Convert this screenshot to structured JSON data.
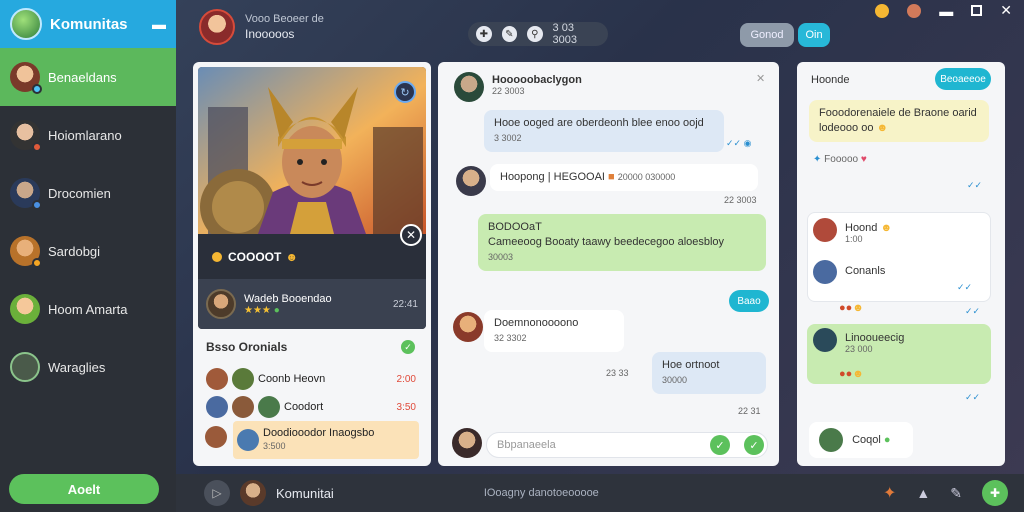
{
  "sidebar": {
    "brand": "Komunitas",
    "items": [
      {
        "label": "Benaeldans",
        "active": true
      },
      {
        "label": "Hoiomlarano"
      },
      {
        "label": "Drocomien"
      },
      {
        "label": "Sardobgi"
      },
      {
        "label": "Hoom Amarta"
      },
      {
        "label": "Waraglies"
      }
    ],
    "bottom_button": "Aoelt"
  },
  "topbar": {
    "subtitle": "Vooo Beoeer de",
    "title": "Inooooos",
    "pill_text": "3 03 3003",
    "button1": "Gonod",
    "button2": "Oin"
  },
  "hero": {
    "name": "COOOOT",
    "user_name": "Wadeb Booendao",
    "time": "22:41"
  },
  "groups": {
    "title": "Bsso Oronials",
    "rows": [
      {
        "label": "Coonb Heovn",
        "time": "2:00"
      },
      {
        "label": "Coodort",
        "time": "3:50"
      },
      {
        "label": "Doodiooodor Inaogsbo",
        "sub": "3:500"
      }
    ]
  },
  "chat": {
    "header_name": "Hooooobaclygon",
    "header_time": "22 3003",
    "messages": [
      {
        "text": "Hooe ooged are oberdeonh blee enoo oojd",
        "time": "3 3002"
      },
      {
        "name": "Hoopong | HEGOOAI",
        "extra": "20000 030000"
      },
      {
        "text": "BODOOaT",
        "text2": "Cameeoog Booaty taawy beedecegoo aloesbloy",
        "time": "30003"
      },
      {
        "button": "Baao"
      },
      {
        "name": "Doemnonoooono",
        "time": "32 3302"
      },
      {
        "text": "Hoe ortnoot",
        "time": "30000"
      }
    ],
    "input_placeholder": "Bbpanaeela"
  },
  "right": {
    "header": "Hoonde",
    "button": "Beoaeeoe",
    "note": "Fooodorenaiele de Braone oarid lodeooo oo",
    "reactions": "Fooooo",
    "contacts": [
      {
        "name": "Hoond",
        "sub": "1:00"
      },
      {
        "name": "Conanls",
        "sub": ""
      },
      {
        "name": "Linooueecig",
        "sub": "23 000"
      },
      {
        "name": "Coqol"
      }
    ]
  },
  "bottombar": {
    "title": "Komunitai",
    "status": "IOoagny danotoeooooe"
  }
}
